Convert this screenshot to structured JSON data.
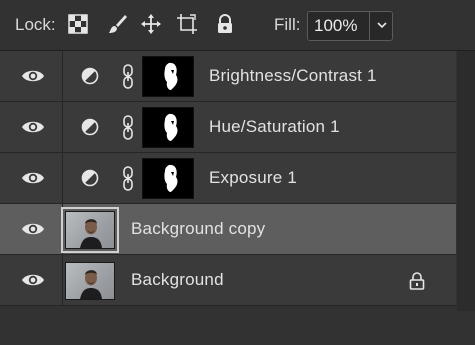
{
  "toolbar": {
    "lock_label": "Lock:",
    "fill_label": "Fill:",
    "fill_value": "100%",
    "icons": [
      "lock-transparent-pixels-icon",
      "lock-image-pixels-icon",
      "lock-position-icon",
      "lock-artboard-icon",
      "lock-all-icon",
      "chevron-down-icon"
    ]
  },
  "layers": [
    {
      "name": "Brightness/Contrast 1",
      "type": "adjustment",
      "visible": true,
      "selected": false
    },
    {
      "name": "Hue/Saturation 1",
      "type": "adjustment",
      "visible": true,
      "selected": false
    },
    {
      "name": "Exposure 1",
      "type": "adjustment",
      "visible": true,
      "selected": false
    },
    {
      "name": "Background copy",
      "type": "pixel",
      "visible": true,
      "selected": true
    },
    {
      "name": "Background",
      "type": "pixel",
      "visible": true,
      "selected": false,
      "locked": true
    }
  ],
  "colors": {
    "panel_bg": "#323232",
    "row_bg": "#3a3a3a",
    "row_selected_bg": "#5e5e5e",
    "text": "#e2e2e2"
  }
}
